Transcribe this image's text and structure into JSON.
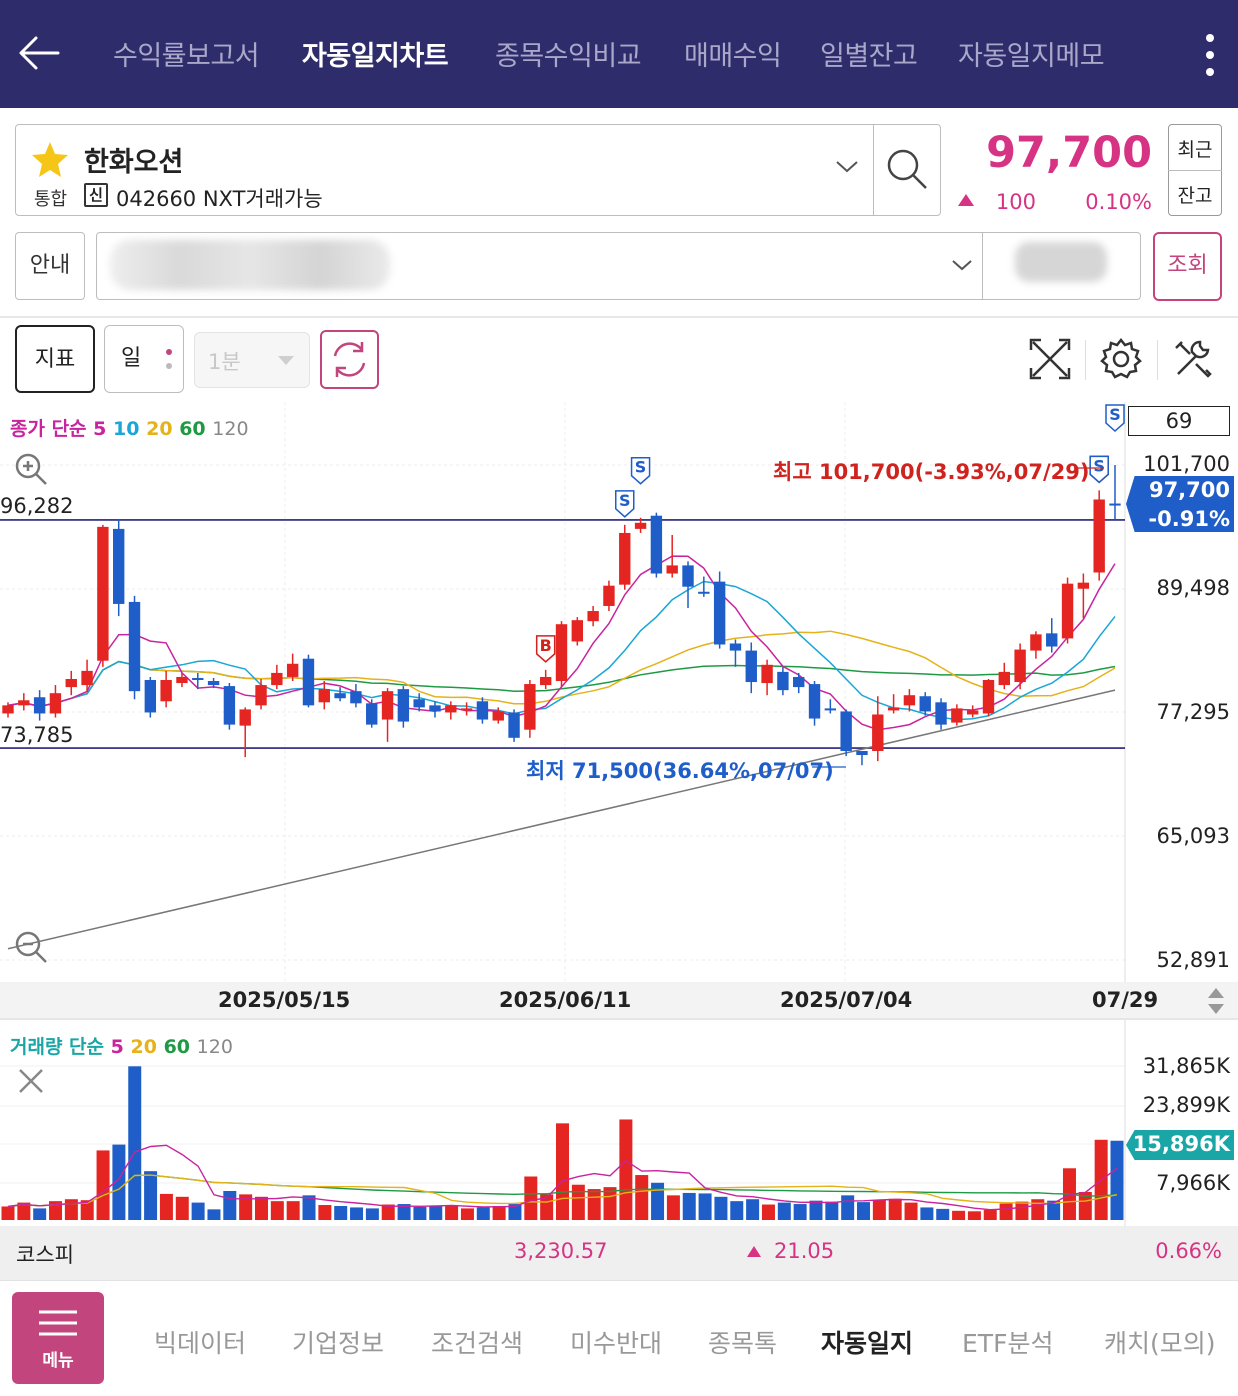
{
  "nav": {
    "tabs": [
      {
        "label": "수익률보고서",
        "active": false
      },
      {
        "label": "자동일지차트",
        "active": true
      },
      {
        "label": "종목수익비교",
        "active": false
      },
      {
        "label": "매매수익",
        "active": false
      },
      {
        "label": "일별잔고",
        "active": false
      },
      {
        "label": "자동일지메모",
        "active": false
      }
    ]
  },
  "stock": {
    "name": "한화오션",
    "market": "통합",
    "credit_badge": "신",
    "code_line": "042660 NXT거래가능",
    "price": "97,700",
    "change": "100",
    "change_pct": "0.10%",
    "side_top": "최근",
    "side_bottom": "잔고"
  },
  "account": {
    "guide_label": "안내",
    "query_label": "조회"
  },
  "toolbar": {
    "indicator_label": "지표",
    "period_label": "일",
    "interval_label": "1분"
  },
  "chart_data": [
    {
      "type": "candlestick",
      "legend": {
        "prefix": "종가 단순",
        "periods": [
          "5",
          "10",
          "20",
          "60",
          "120"
        ]
      },
      "y_ticks": [
        "101,700",
        "89,498",
        "77,295",
        "65,093",
        "52,891"
      ],
      "ylim": [
        52891,
        101700
      ],
      "x_ticks": [
        "2025/05/15",
        "2025/06/11",
        "2025/07/04",
        "07/29"
      ],
      "top_right_value": "69",
      "hlines": [
        {
          "label": "96,282",
          "value": 96282
        },
        {
          "label": "73,785",
          "value": 73785
        }
      ],
      "current_price": "97,700",
      "current_change": "-0.91%",
      "high_annotation": "최고 101,700(-3.93%,07/29)",
      "low_annotation": "최저 71,500(36.64%,07/07)",
      "colors": {
        "up": "#e52521",
        "down": "#1f5ec8",
        "ma5": "#c9239e",
        "ma10": "#1aa6d6",
        "ma20": "#e5b21a",
        "ma60": "#1e9a44",
        "ma120": "#777777"
      },
      "candles": [
        [
          77.2,
          78.0,
          76.8,
          78.3
        ],
        [
          78.0,
          78.5,
          77.5,
          79.2
        ],
        [
          78.8,
          77.2,
          76.5,
          79.5
        ],
        [
          77.2,
          79.2,
          76.8,
          80.0
        ],
        [
          79.8,
          80.6,
          79.0,
          81.4
        ],
        [
          80.0,
          81.4,
          79.4,
          82.5
        ],
        [
          82.4,
          95.6,
          81.8,
          95.8
        ],
        [
          95.4,
          88.0,
          86.8,
          96.3
        ],
        [
          88.2,
          79.4,
          78.6,
          88.8
        ],
        [
          80.5,
          77.3,
          76.8,
          80.8
        ],
        [
          78.4,
          80.5,
          77.8,
          81.4
        ],
        [
          80.2,
          80.8,
          79.8,
          81.2
        ],
        [
          80.7,
          80.5,
          79.6,
          81.2
        ],
        [
          80.4,
          80.0,
          79.7,
          80.7
        ],
        [
          79.9,
          76.1,
          75.6,
          80.2
        ],
        [
          76.0,
          77.6,
          72.9,
          77.8
        ],
        [
          78.0,
          80.0,
          77.6,
          80.6
        ],
        [
          80.0,
          81.2,
          79.6,
          82.0
        ],
        [
          80.8,
          82.1,
          80.4,
          83.1
        ],
        [
          82.6,
          78.0,
          77.8,
          83.0
        ],
        [
          78.3,
          79.6,
          77.6,
          80.4
        ],
        [
          79.2,
          78.7,
          78.4,
          79.8
        ],
        [
          79.4,
          78.2,
          77.8,
          80.1
        ],
        [
          78.2,
          76.1,
          75.8,
          78.6
        ],
        [
          76.6,
          79.4,
          74.4,
          79.7
        ],
        [
          79.6,
          76.4,
          75.8,
          79.9
        ],
        [
          78.6,
          77.8,
          77.4,
          79.2
        ],
        [
          78.0,
          77.4,
          76.8,
          78.4
        ],
        [
          77.3,
          78.0,
          76.6,
          78.4
        ],
        [
          77.7,
          77.7,
          77.0,
          78.3
        ],
        [
          78.4,
          76.6,
          76.2,
          78.8
        ],
        [
          76.5,
          77.4,
          76.2,
          77.8
        ],
        [
          77.3,
          74.8,
          74.4,
          77.6
        ],
        [
          75.6,
          80.1,
          74.8,
          80.5
        ],
        [
          80.0,
          80.8,
          79.6,
          81.5
        ],
        [
          80.4,
          86.0,
          79.8,
          86.3
        ],
        [
          84.3,
          86.4,
          83.9,
          86.7
        ],
        [
          86.3,
          87.3,
          85.8,
          87.8
        ],
        [
          87.8,
          89.8,
          87.3,
          90.3
        ],
        [
          89.9,
          95.0,
          89.4,
          95.8
        ],
        [
          95.4,
          96.0,
          95.0,
          96.5
        ],
        [
          96.7,
          91.0,
          90.6,
          97.0
        ],
        [
          91.0,
          91.8,
          90.6,
          94.8
        ],
        [
          91.8,
          89.7,
          87.6,
          92.2
        ],
        [
          89.2,
          89.1,
          88.7,
          90.7
        ],
        [
          90.2,
          84.0,
          83.6,
          91.2
        ],
        [
          84.1,
          83.4,
          81.8,
          84.5
        ],
        [
          83.4,
          80.3,
          79.2,
          84.2
        ],
        [
          80.2,
          82.0,
          79.0,
          82.5
        ],
        [
          81.3,
          79.5,
          79.0,
          81.8
        ],
        [
          80.8,
          79.8,
          79.2,
          81.2
        ],
        [
          80.1,
          76.7,
          76.0,
          80.4
        ],
        [
          77.7,
          77.6,
          77.2,
          78.6
        ],
        [
          77.4,
          73.5,
          73.0,
          77.6
        ],
        [
          73.5,
          73.1,
          72.1,
          73.4
        ],
        [
          73.5,
          77.1,
          72.5,
          78.9
        ],
        [
          77.5,
          77.8,
          77.2,
          79.1
        ],
        [
          78.0,
          79.0,
          77.4,
          79.6
        ],
        [
          78.9,
          77.4,
          77.0,
          79.3
        ],
        [
          78.3,
          76.1,
          75.6,
          78.7
        ],
        [
          76.3,
          77.7,
          76.0,
          78.1
        ],
        [
          77.1,
          77.5,
          76.8,
          78.0
        ],
        [
          77.2,
          80.5,
          76.9,
          80.6
        ],
        [
          80.0,
          81.3,
          79.6,
          82.2
        ],
        [
          80.3,
          83.5,
          79.6,
          84.1
        ],
        [
          83.4,
          85.0,
          82.6,
          85.3
        ],
        [
          85.1,
          83.8,
          83.2,
          86.6
        ],
        [
          84.6,
          90.0,
          84.1,
          90.6
        ],
        [
          89.5,
          90.1,
          86.6,
          91.0
        ],
        [
          91.1,
          98.3,
          90.3,
          99.2
        ],
        [
          97.9,
          97.7,
          96.3,
          101.7
        ]
      ],
      "buy_markers": [
        34,
        69
      ],
      "sell_markers": [
        39,
        40,
        69,
        70
      ]
    },
    {
      "type": "bar",
      "legend": {
        "prefix": "거래량 단순",
        "periods": [
          "5",
          "20",
          "60",
          "120"
        ]
      },
      "y_ticks": [
        "31,865K",
        "23,899K",
        "15,896K",
        "7,966K"
      ],
      "current_value": "15,896K",
      "volumes": [
        2.8,
        3.6,
        2.4,
        3.9,
        4.3,
        4.1,
        14.4,
        15.6,
        31.8,
        10.1,
        5.4,
        4.8,
        3.6,
        2.2,
        6.0,
        5.3,
        4.8,
        3.9,
        3.9,
        5.1,
        3.1,
        2.9,
        2.6,
        2.4,
        3.2,
        3.3,
        2.7,
        3.0,
        2.9,
        2.4,
        2.6,
        2.9,
        3.3,
        9.0,
        5.3,
        20.0,
        7.3,
        6.4,
        6.8,
        20.8,
        9.3,
        7.7,
        5.1,
        5.6,
        5.5,
        4.8,
        3.9,
        4.3,
        3.2,
        3.6,
        3.3,
        4.0,
        3.8,
        5.1,
        3.7,
        4.2,
        4.4,
        3.6,
        2.6,
        2.3,
        1.9,
        1.8,
        2.1,
        3.4,
        3.8,
        4.3,
        4.0,
        10.7,
        5.8,
        16.6,
        16.4
      ]
    }
  ],
  "index": {
    "name": "코스피",
    "value": "3,230.57",
    "change": "21.05",
    "change_pct": "0.66%"
  },
  "bottom_nav": {
    "menu_label": "메뉴",
    "items": [
      {
        "label": "빅데이터",
        "active": false
      },
      {
        "label": "기업정보",
        "active": false
      },
      {
        "label": "조건검색",
        "active": false
      },
      {
        "label": "미수반대",
        "active": false
      },
      {
        "label": "종목톡",
        "active": false
      },
      {
        "label": "자동일지",
        "active": true
      },
      {
        "label": "ETF분석",
        "active": false
      },
      {
        "label": "캐치(모의)",
        "active": false
      }
    ]
  }
}
